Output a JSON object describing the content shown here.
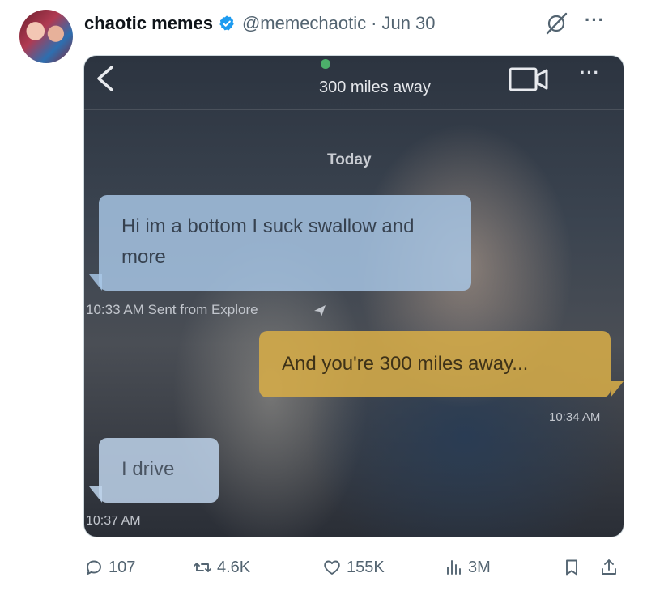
{
  "author": {
    "display_name": "chaotic memes",
    "handle": "@memechaotic",
    "separator": "·",
    "date": "Jun 30",
    "verified": true
  },
  "media": {
    "header_title": "300 miles away",
    "day_label": "Today",
    "messages": [
      {
        "text": "Hi im a bottom I suck swallow and more",
        "side": "left",
        "timestamp": "10:33 AM Sent from Explore"
      },
      {
        "text": "And you're 300 miles away...",
        "side": "right",
        "timestamp": "10:34 AM"
      },
      {
        "text": "I drive",
        "side": "left",
        "timestamp": "10:37 AM"
      }
    ]
  },
  "actions": {
    "replies": "107",
    "reposts": "4.6K",
    "likes": "155K",
    "views": "3M"
  },
  "colors": {
    "verified_blue": "#1d9bf0",
    "text_secondary": "#536471",
    "online_green": "#4caf6a",
    "sent_bubble": "#d6ac48",
    "received_bubble": "#aac8e8"
  },
  "icons": [
    "grok-icon",
    "more-icon",
    "back-chevron-icon",
    "video-call-icon",
    "send-arrow-icon",
    "reply-icon",
    "repost-icon",
    "like-icon",
    "views-icon",
    "bookmark-icon",
    "share-icon"
  ]
}
